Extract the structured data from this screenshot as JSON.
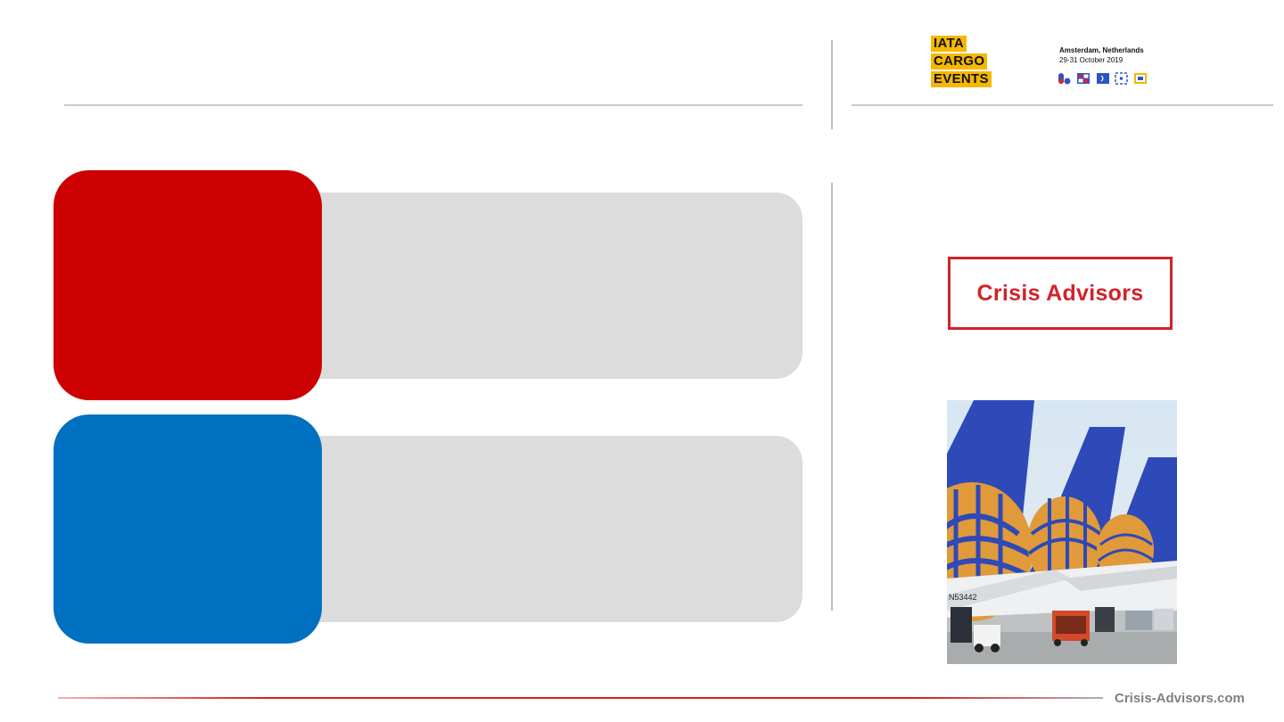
{
  "header": {
    "iata_logo": {
      "words": [
        "IATA",
        "CARGO",
        "EVENTS"
      ],
      "location": "Amsterdam, Netherlands",
      "dates": "29-31 October 2019",
      "brand_color": "#f5b800"
    }
  },
  "sidebar": {
    "logo_text": "Crisis Advisors",
    "logo_color": "#d1232a",
    "photo": {
      "tail_number": "N53442"
    }
  },
  "blocks": [
    {
      "tile_color": "#cc0000",
      "bar_color": "#dcdcdc"
    },
    {
      "tile_color": "#0070c0",
      "bar_color": "#dcdcdc"
    }
  ],
  "footer": {
    "website": "Crisis-Advisors.com",
    "rule_color": "#d42020"
  }
}
